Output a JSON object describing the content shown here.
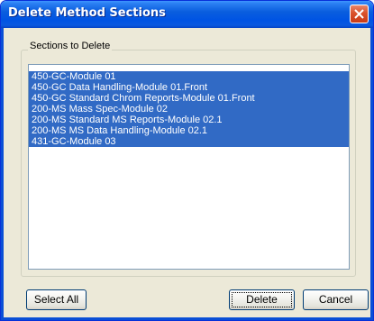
{
  "window": {
    "title": "Delete Method Sections",
    "close_icon": "close-icon"
  },
  "group": {
    "label": "Sections to Delete"
  },
  "list": {
    "items": [
      {
        "label": "450-GC-Module 01",
        "selected": true
      },
      {
        "label": "450-GC Data Handling-Module 01.Front",
        "selected": true
      },
      {
        "label": "450-GC Standard Chrom Reports-Module 01.Front",
        "selected": true
      },
      {
        "label": "200-MS Mass Spec-Module 02",
        "selected": true
      },
      {
        "label": "200-MS Standard MS Reports-Module 02.1",
        "selected": true
      },
      {
        "label": "200-MS MS Data Handling-Module 02.1",
        "selected": true
      },
      {
        "label": "431-GC-Module 03",
        "selected": true
      }
    ]
  },
  "buttons": {
    "select_all": "Select All",
    "delete": "Delete",
    "cancel": "Cancel"
  },
  "colors": {
    "selection_bg": "#316ac5",
    "dialog_bg": "#ece9d8",
    "titlebar": "#0054e3",
    "close_button": "#d9512b"
  }
}
